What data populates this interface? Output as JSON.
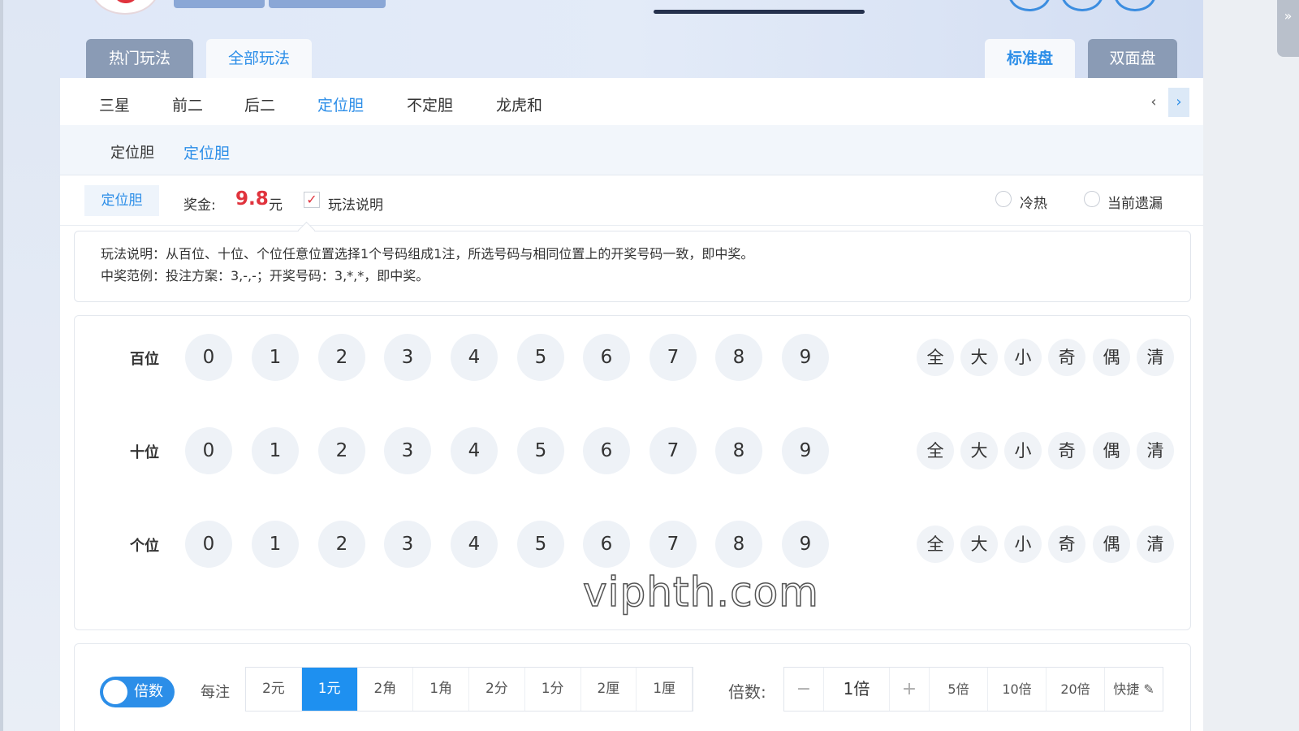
{
  "header": {
    "tabs_left": [
      "热门玩法",
      "全部玩法"
    ],
    "tabs_right": [
      "标准盘",
      "双面盘"
    ]
  },
  "subnav": {
    "items": [
      "三星",
      "前二",
      "后二",
      "定位胆",
      "不定胆",
      "龙虎和"
    ],
    "active_index": 3,
    "prev_icon": "chevron-left-icon",
    "next_icon": "chevron-right-icon"
  },
  "subsub": {
    "items": [
      "定位胆",
      "定位胆"
    ]
  },
  "info": {
    "mode": "定位胆",
    "prize_label": "奖金:",
    "prize_value": "9.8",
    "prize_unit": "元",
    "rules_checkbox_label": "玩法说明",
    "rules_checked": true,
    "radio_hot_cold": "冷热",
    "radio_missing": "当前遗漏"
  },
  "description": {
    "line1": "玩法说明：从百位、十位、个位任意位置选择1个号码组成1注，所选号码与相同位置上的开奖号码一致，即中奖。",
    "line2": "中奖范例：投注方案：3,-,-；开奖号码：3,*,*，即中奖。"
  },
  "board": {
    "rows": [
      {
        "label": "百位"
      },
      {
        "label": "十位"
      },
      {
        "label": "个位"
      }
    ],
    "numbers": [
      "0",
      "1",
      "2",
      "3",
      "4",
      "5",
      "6",
      "7",
      "8",
      "9"
    ],
    "quick_buttons": [
      "全",
      "大",
      "小",
      "奇",
      "偶",
      "清"
    ]
  },
  "watermark": "viphth.com",
  "bottom": {
    "toggle_label": "倍数",
    "per_bet_label": "每注",
    "units": [
      "2元",
      "1元",
      "2角",
      "1角",
      "2分",
      "1分",
      "2厘",
      "1厘"
    ],
    "active_unit_index": 1,
    "multiplier_label": "倍数:",
    "multiplier_value": "1倍",
    "minus": "−",
    "plus": "+",
    "presets": [
      "5倍",
      "10倍",
      "20倍",
      "快捷"
    ]
  },
  "colors": {
    "accent": "#2c8ee8",
    "prize": "#e0333d",
    "tab_grey": "#8a9bb5"
  }
}
